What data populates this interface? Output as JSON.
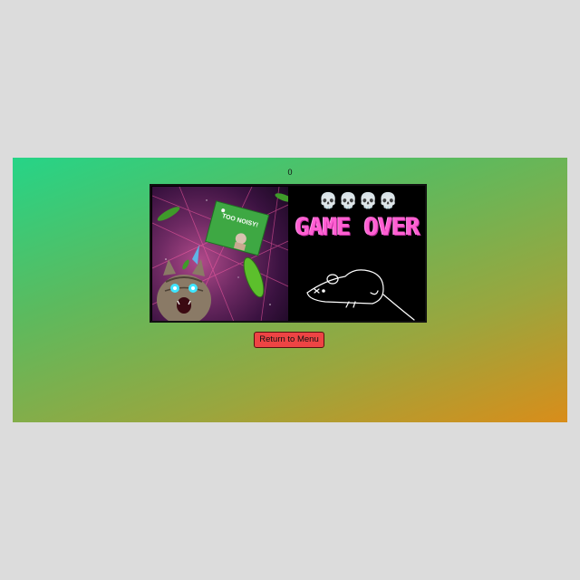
{
  "game": {
    "score": "0"
  },
  "gameover": {
    "skulls": [
      "💀",
      "💀",
      "💀",
      "💀"
    ],
    "title": "GAME OVER",
    "sign_text": "TOO NOISY!",
    "title_color": "#ff5fd2"
  },
  "menu": {
    "return_label": "Return to Menu"
  },
  "colors": {
    "gradient_start": "#26d487",
    "gradient_end": "#d98d1a",
    "button": "#ee4444",
    "page_background": "#dcdcdc"
  }
}
